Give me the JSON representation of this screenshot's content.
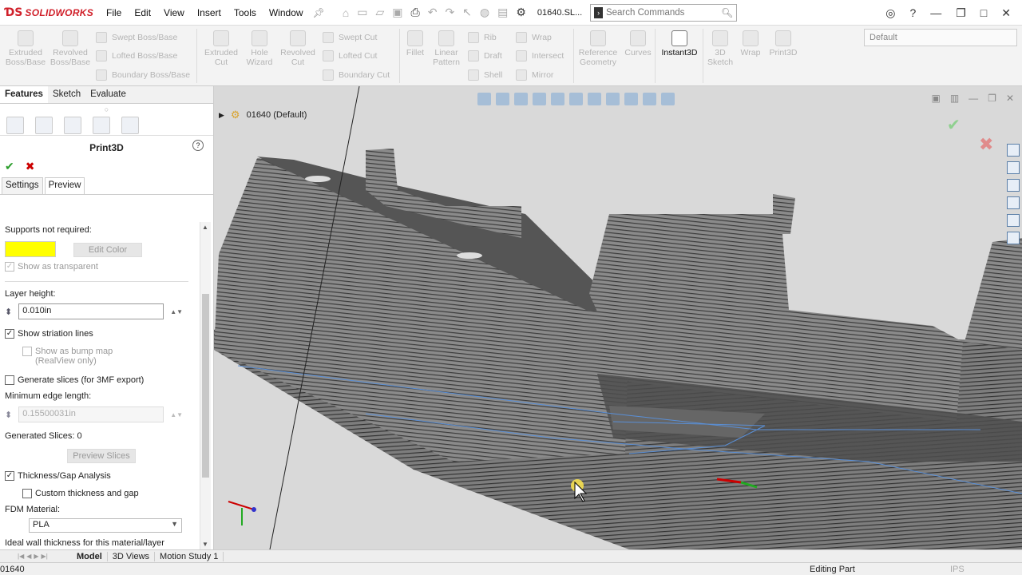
{
  "app": {
    "brand": "SOLIDWORKS",
    "doc_title": "01640.SL..."
  },
  "menu": [
    "File",
    "Edit",
    "View",
    "Insert",
    "Tools",
    "Window"
  ],
  "search": {
    "placeholder": "Search Commands"
  },
  "ribbon": {
    "extruded_boss": "Extruded Boss/Base",
    "revolved_boss": "Revolved Boss/Base",
    "swept_boss": "Swept Boss/Base",
    "lofted_boss": "Lofted Boss/Base",
    "boundary_boss": "Boundary Boss/Base",
    "extruded_cut": "Extruded Cut",
    "hole_wizard": "Hole Wizard",
    "revolved_cut": "Revolved Cut",
    "swept_cut": "Swept Cut",
    "lofted_cut": "Lofted Cut",
    "boundary_cut": "Boundary Cut",
    "fillet": "Fillet",
    "linear_pattern": "Linear Pattern",
    "rib": "Rib",
    "draft": "Draft",
    "shell": "Shell",
    "wrap": "Wrap",
    "intersect": "Intersect",
    "mirror": "Mirror",
    "reference_geometry": "Reference Geometry",
    "curves": "Curves",
    "instant3d": "Instant3D",
    "sketch3d": "3D Sketch",
    "wrap2": "Wrap",
    "print3d": "Print3D",
    "configuration": "Default"
  },
  "panel_tabs": [
    "Features",
    "Sketch",
    "Evaluate"
  ],
  "pm": {
    "title": "Print3D",
    "subtabs": [
      "Settings",
      "Preview"
    ],
    "supports_label": "Supports not required:",
    "supports_color": "#ffff00",
    "edit_color": "Edit Color",
    "show_transparent": "Show as transparent",
    "layer_height_label": "Layer height:",
    "layer_height": "0.010in",
    "show_striation": "Show striation lines",
    "bump_map": "Show as bump map",
    "realview": "(RealView only)",
    "generate_slices": "Generate slices (for 3MF export)",
    "min_edge_label": "Minimum edge length:",
    "min_edge": "0.15500031in",
    "generated_slices_label": "Generated Slices:",
    "generated_slices": "0",
    "preview_slices": "Preview Slices",
    "thickness_gap": "Thickness/Gap Analysis",
    "custom_thickness": "Custom thickness and gap",
    "fdm_label": "FDM Material:",
    "fdm_value": "PLA",
    "ideal_wall": "Ideal wall thickness for this material/layer"
  },
  "viewport": {
    "tree_label": "01640  (Default)"
  },
  "bottom_tabs": [
    "Model",
    "3D Views",
    "Motion Study 1"
  ],
  "status": {
    "doc": "01640",
    "mode": "Editing Part",
    "units": "IPS"
  }
}
